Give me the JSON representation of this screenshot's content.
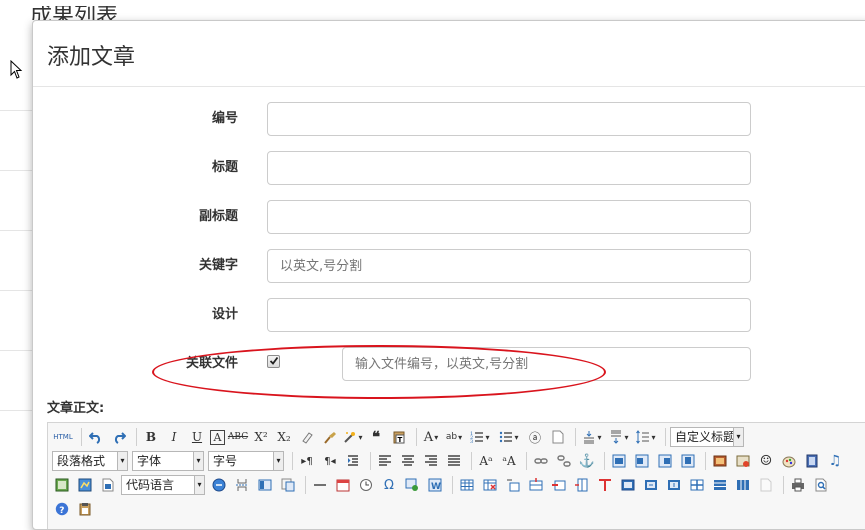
{
  "background": {
    "page_title": "成果列表"
  },
  "modal": {
    "title": "添加文章"
  },
  "form": {
    "fields": [
      {
        "label": "编号",
        "value": "",
        "placeholder": ""
      },
      {
        "label": "标题",
        "value": "",
        "placeholder": ""
      },
      {
        "label": "副标题",
        "value": "",
        "placeholder": ""
      },
      {
        "label": "关键字",
        "value": "",
        "placeholder": "以英文,号分割"
      },
      {
        "label": "设计",
        "value": "",
        "placeholder": ""
      }
    ],
    "related": {
      "label": "关联文件",
      "checked": true,
      "placeholder": "输入文件编号，以英文,号分割"
    },
    "body_label": "文章正文:"
  },
  "editor": {
    "html_label": "HTML",
    "paragraph_format": "段落格式",
    "font_family": "字体",
    "font_size": "字号",
    "custom_title": "自定义标题",
    "code_language": "代码语言",
    "highlight_color": "#d9141d"
  }
}
